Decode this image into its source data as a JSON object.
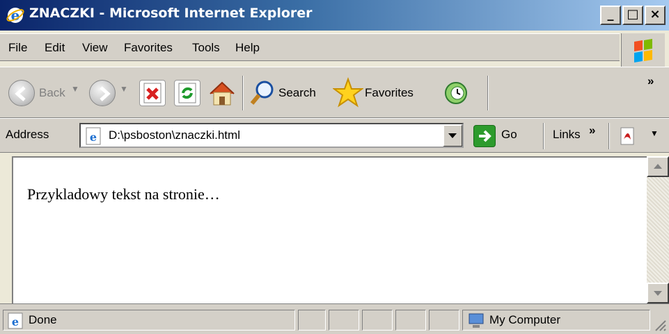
{
  "window": {
    "title": "ZNACZKI - Microsoft Internet Explorer",
    "controls": {
      "minimize": "_",
      "maximize": "□",
      "close": "×"
    }
  },
  "menu": [
    {
      "label": "File"
    },
    {
      "label": "Edit"
    },
    {
      "label": "View"
    },
    {
      "label": "Favorites"
    },
    {
      "label": "Tools"
    },
    {
      "label": "Help"
    }
  ],
  "toolbar": {
    "back_label": "Back",
    "search_label": "Search",
    "favorites_label": "Favorites",
    "overflow": "»"
  },
  "address": {
    "label": "Address",
    "value": "D:\\psboston\\znaczki.html",
    "go_label": "Go",
    "links_label": "Links",
    "links_overflow": "»"
  },
  "content": {
    "text": "Przykladowy tekst na stronie…"
  },
  "status": {
    "text": "Done",
    "zone": "My Computer"
  },
  "colors": {
    "titlebar_start": "#0a246a",
    "titlebar_end": "#a6caf0",
    "chrome": "#d4d0c8",
    "go_green": "#2d9b2d"
  }
}
